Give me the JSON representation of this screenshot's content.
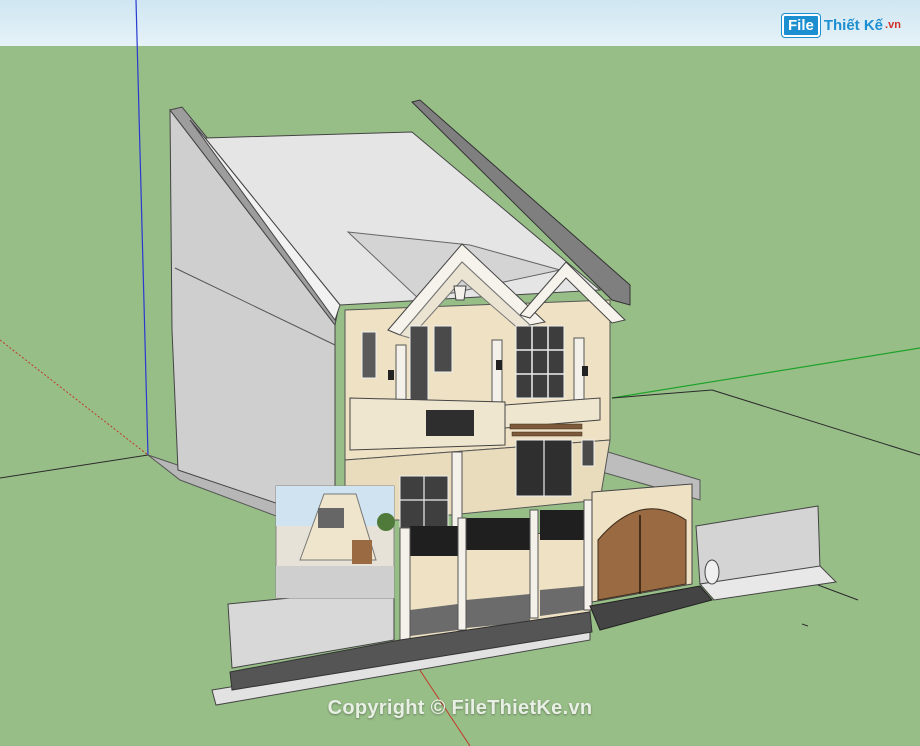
{
  "app": {
    "logo_badge": "File",
    "logo_text": "Thiết Kế",
    "logo_suffix": ".vn"
  },
  "overlay": {
    "copyright": "Copyright © FileThietKe.vn"
  },
  "colors": {
    "ground": "#98be88",
    "sky": "#dbecf4",
    "wall_gray": "#c9c9c9",
    "facade_cream": "#efe2c4",
    "trim_white": "#f4f1ea",
    "gate_wood": "#9a6a43",
    "axis_red": "#c0392b",
    "axis_green": "#1fa22a",
    "axis_blue": "#2a3ad0",
    "logo_blue": "#1b8fd0",
    "logo_red": "#d0302a"
  }
}
